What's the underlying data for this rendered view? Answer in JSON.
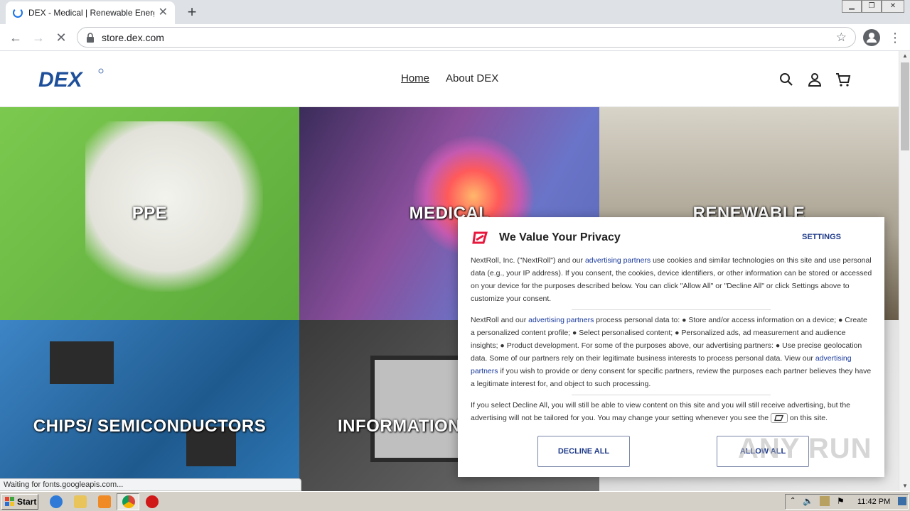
{
  "browser": {
    "tab_title": "DEX - Medical | Renewable Energy |",
    "url": "store.dex.com",
    "status_text": "Waiting for fonts.googleapis.com..."
  },
  "site": {
    "logo_text": "DEX",
    "nav": {
      "home": "Home",
      "about": "About DEX"
    },
    "tiles": [
      {
        "label": "PPE",
        "color": "#6ebf44"
      },
      {
        "label": "MEDICAL",
        "color": "#7a4fa8"
      },
      {
        "label": "RENEWABLE",
        "color": "#b9b2a3"
      },
      {
        "label": "CHIPS/ SEMICONDUCTORS",
        "color": "#2a6fa8"
      },
      {
        "label": "INFORMATION",
        "color": "#4a4a4a"
      }
    ]
  },
  "consent": {
    "title": "We Value Your Privacy",
    "settings_label": "SETTINGS",
    "p1_a": "NextRoll, Inc. (\"NextRoll\") and our ",
    "p1_link": "advertising partners",
    "p1_b": " use cookies and similar technologies on this site and use personal data (e.g., your IP address). If you consent, the cookies, device identifiers, or other information can be stored or accessed on your device for the purposes described below. You can click \"Allow All\" or \"Decline All\" or click Settings above to customize your consent.",
    "p2_a": "NextRoll and our ",
    "p2_link1": "advertising partners",
    "p2_b": " process personal data to: ● Store and/or access information on a device; ● Create a personalized content profile; ● Select personalised content; ● Personalized ads, ad measurement and audience insights; ● Product development. For some of the purposes above, our advertising partners: ● Use precise geolocation data. Some of our partners rely on their legitimate business interests to process personal data. View our ",
    "p2_link2": "advertising partners",
    "p2_c": " if you wish to provide or deny consent for specific partners, review the purposes each partner believes they have a legitimate interest for, and object to such processing.",
    "p3_a": "If you select Decline All, you will still be able to view content on this site and you will still receive advertising, but the advertising will not be tailored for you. You may change your setting whenever you see the ",
    "p3_b": " on this site.",
    "decline_label": "DECLINE ALL",
    "allow_label": "ALLOW ALL",
    "accent_color": "#e8173c"
  },
  "watermark": "ANY RUN",
  "taskbar": {
    "start_label": "Start",
    "clock": "11:42 PM"
  }
}
